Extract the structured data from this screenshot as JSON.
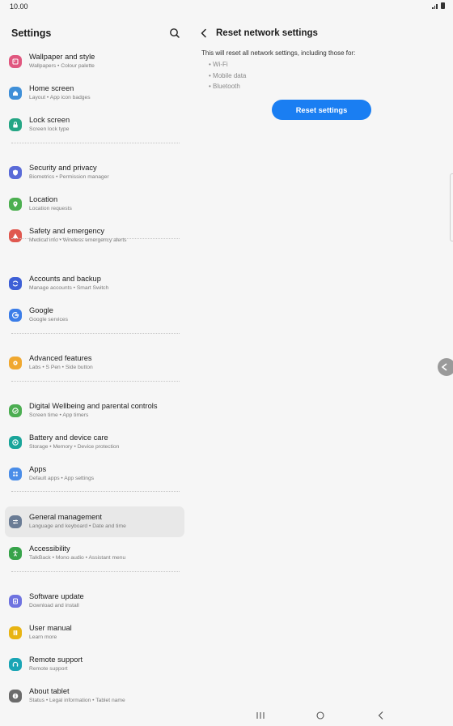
{
  "status_bar": {
    "time": "10.00"
  },
  "left_panel": {
    "title": "Settings",
    "items": [
      {
        "title": "Wallpaper and style",
        "subtitle": "Wallpapers  •  Colour palette",
        "icon": "wallpaper-icon",
        "color": "#e0577f"
      },
      {
        "title": "Home screen",
        "subtitle": "Layout  •  App icon badges",
        "icon": "home-icon",
        "color": "#3f8fd8"
      },
      {
        "title": "Lock screen",
        "subtitle": "Screen lock type",
        "icon": "lock-icon",
        "color": "#25a685"
      },
      {
        "title": "Security and privacy",
        "subtitle": "Biometrics  •  Permission manager",
        "icon": "shield-icon",
        "color": "#5a6bd8"
      },
      {
        "title": "Location",
        "subtitle": "Location requests",
        "icon": "location-icon",
        "color": "#4caf50"
      },
      {
        "title": "Safety and emergency",
        "subtitle": "Medical info  •  Wireless emergency alerts",
        "icon": "emergency-icon",
        "color": "#e0584f"
      },
      {
        "title": "Accounts and backup",
        "subtitle": "Manage accounts  •  Smart Switch",
        "icon": "sync-icon",
        "color": "#3d5fd6"
      },
      {
        "title": "Google",
        "subtitle": "Google services",
        "icon": "google-icon",
        "color": "#3b7de8"
      },
      {
        "title": "Advanced features",
        "subtitle": "Labs  •  S Pen  •  Side button",
        "icon": "gear-plus-icon",
        "color": "#f0a830"
      },
      {
        "title": "Digital Wellbeing and parental controls",
        "subtitle": "Screen time  •  App timers",
        "icon": "wellbeing-icon",
        "color": "#4cae52"
      },
      {
        "title": "Battery and device care",
        "subtitle": "Storage  •  Memory  •  Device protection",
        "icon": "device-care-icon",
        "color": "#1aa59a"
      },
      {
        "title": "Apps",
        "subtitle": "Default apps  •  App settings",
        "icon": "apps-icon",
        "color": "#4a8de8"
      },
      {
        "title": "General management",
        "subtitle": "Language and keyboard  •  Date and time",
        "icon": "sliders-icon",
        "color": "#6a7c95"
      },
      {
        "title": "Accessibility",
        "subtitle": "TalkBack  •  Mono audio  •  Assistant menu",
        "icon": "accessibility-icon",
        "color": "#37a34a"
      },
      {
        "title": "Software update",
        "subtitle": "Download and install",
        "icon": "update-icon",
        "color": "#6f73e0"
      },
      {
        "title": "User manual",
        "subtitle": "Learn more",
        "icon": "manual-icon",
        "color": "#e8b413"
      },
      {
        "title": "Remote support",
        "subtitle": "Remote support",
        "icon": "headset-icon",
        "color": "#1aa5b5"
      },
      {
        "title": "About tablet",
        "subtitle": "Status  •  Legal information  •  Tablet name",
        "icon": "info-icon",
        "color": "#6b6b6b"
      }
    ]
  },
  "right_panel": {
    "title": "Reset network settings",
    "description": "This will reset all network settings, including those for:",
    "bullets": [
      "• Wi-Fi",
      "• Mobile data",
      "• Bluetooth"
    ],
    "button_label": "Reset settings",
    "accent_color": "#1a7ef2"
  }
}
